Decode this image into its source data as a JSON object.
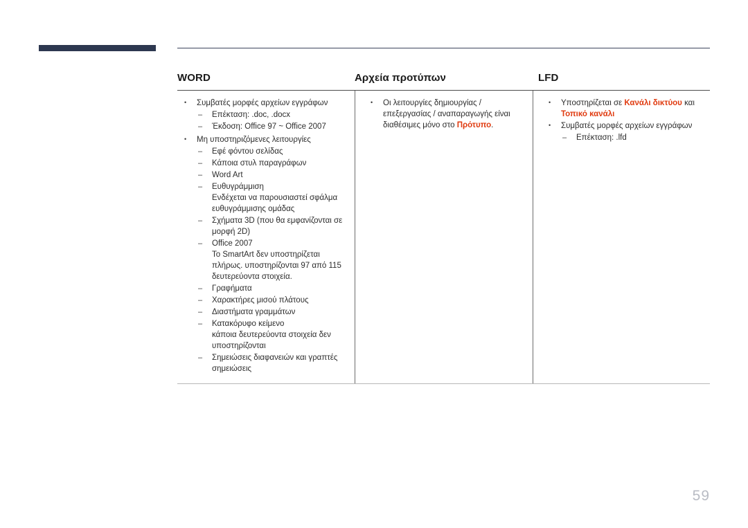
{
  "page": {
    "number": "59",
    "accent_color": "#e03b10",
    "bar_color": "#2d3850"
  },
  "table": {
    "headers": [
      {
        "label": "WORD"
      },
      {
        "label": "Αρχεία προτύπων"
      },
      {
        "label": "LFD"
      }
    ],
    "columns": [
      {
        "name": "word",
        "items": [
          {
            "text": "Συμβατές μορφές αρχείων εγγράφων",
            "sub": [
              {
                "text": "Επέκταση: .doc, .docx"
              },
              {
                "text": "Έκδοση: Office 97 ~ Office 2007"
              }
            ]
          },
          {
            "text": "Μη υποστηριζόμενες λειτουργίες",
            "sub": [
              {
                "text": "Εφέ φόντου σελίδας"
              },
              {
                "text": "Κάποια στυλ παραγράφων"
              },
              {
                "text": "Word Art"
              },
              {
                "text": "Ευθυγράμμιση",
                "note": "Ενδέχεται να παρουσιαστεί σφάλμα ευθυγράμμισης ομάδας"
              },
              {
                "text": "Σχήματα 3D (που θα εμφανίζονται σε μορφή 2D)"
              },
              {
                "text": "Office 2007",
                "note": "Το SmartArt δεν υποστηρίζεται πλήρως. υποστηρίζονται 97 από 115 δευτερεύοντα στοιχεία."
              },
              {
                "text": "Γραφήματα"
              },
              {
                "text": "Χαρακτήρες μισού πλάτους"
              },
              {
                "text": "Διαστήματα γραμμάτων"
              },
              {
                "text": "Κατακόρυφο κείμενο",
                "note": "κάποια δευτερεύοντα στοιχεία δεν υποστηρίζονται"
              },
              {
                "text": "Σημειώσεις διαφανειών και γραπτές σημειώσεις"
              }
            ]
          }
        ]
      },
      {
        "name": "template-files",
        "items": [
          {
            "text_before": "Οι λειτουργίες δημιουργίας / επεξεργασίας / αναπαραγωγής είναι διαθέσιμες μόνο στο ",
            "highlight": "Πρότυπο",
            "text_after": "."
          }
        ]
      },
      {
        "name": "lfd",
        "items": [
          {
            "text_before": "Υποστηρίζεται σε ",
            "highlight": "Κανάλι δικτύου",
            "text_mid": " και ",
            "highlight2": "Τοπικό κανάλι"
          },
          {
            "text": "Συμβατές μορφές αρχείων εγγράφων",
            "sub": [
              {
                "text": "Επέκταση: .lfd"
              }
            ]
          }
        ]
      }
    ]
  }
}
